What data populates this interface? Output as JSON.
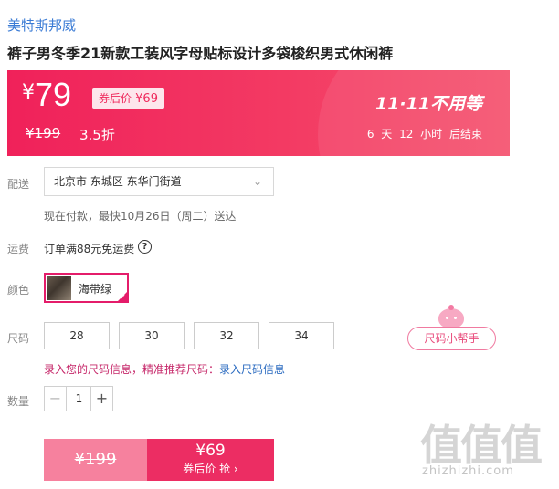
{
  "product": {
    "brand": "美特斯邦威",
    "title": "裤子男冬季21新款工装风字母贴标设计多袋梭织男式休闲裤"
  },
  "price_banner": {
    "currency_symbol": "¥",
    "current_price": "79",
    "coupon_label": "券后价",
    "coupon_price": "¥69",
    "original_price": "¥199",
    "discount": "3.5折",
    "event_title": "11·11不用等",
    "countdown": "6 天 12 小时 后结束",
    "colors": {
      "start": "#f0215a",
      "end": "#f5526e"
    }
  },
  "delivery": {
    "label": "配送",
    "address": "北京市 东城区 东华门街道",
    "note": "现在付款，最快10月26日（周二）送达"
  },
  "shipping": {
    "label": "运费",
    "text": "订单满88元免运费",
    "help_glyph": "?"
  },
  "color": {
    "label": "颜色",
    "selected": "海带绿",
    "accent": "#e41c6a"
  },
  "size": {
    "label": "尺码",
    "options": [
      "28",
      "30",
      "32",
      "34"
    ],
    "helper_label": "尺码小帮手",
    "prompt_text": "录入您的尺码信息，精准推荐尺码：",
    "prompt_link": "录入尺码信息"
  },
  "quantity": {
    "label": "数量",
    "value": "1",
    "minus": "−",
    "plus": "+"
  },
  "buy": {
    "original_price": "¥199",
    "coupon_price": "¥69",
    "coupon_label": "券后价 抢 ›"
  },
  "watermark": {
    "logo_text": "值值值",
    "url": "zhizhizhi.com"
  }
}
